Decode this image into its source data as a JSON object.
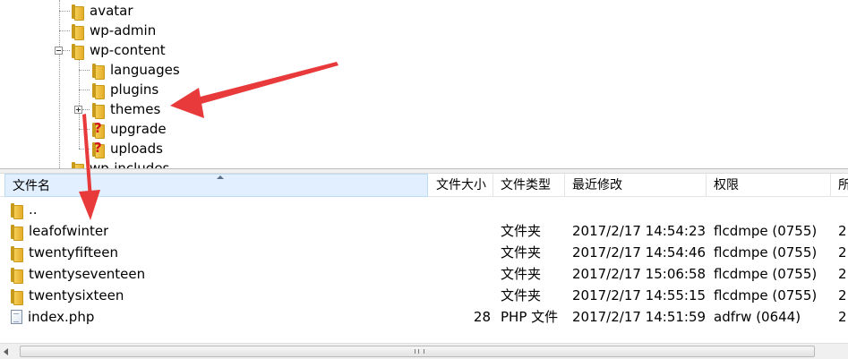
{
  "tree": {
    "items": [
      {
        "label": "avatar",
        "icon": "folder-icon"
      },
      {
        "label": "wp-admin",
        "icon": "folder-icon"
      },
      {
        "label": "wp-content",
        "icon": "folder-icon",
        "expanded": true
      },
      {
        "label": "languages",
        "icon": "folder-icon"
      },
      {
        "label": "plugins",
        "icon": "folder-icon"
      },
      {
        "label": "themes",
        "icon": "folder-icon",
        "collapsed_children": true
      },
      {
        "label": "upgrade",
        "icon": "unknown-folder-icon"
      },
      {
        "label": "uploads",
        "icon": "unknown-folder-icon"
      },
      {
        "label": "wp-includes",
        "icon": "folder-icon"
      }
    ]
  },
  "file_list": {
    "columns": {
      "name": "文件名",
      "size": "文件大小",
      "type": "文件类型",
      "modified": "最近修改",
      "permissions": "权限",
      "owner": "所"
    },
    "rows": [
      {
        "name": "..",
        "size": "",
        "type": "",
        "modified": "",
        "permissions": "",
        "owner": "",
        "icon": "folder-icon"
      },
      {
        "name": "leafofwinter",
        "size": "",
        "type": "文件夹",
        "modified": "2017/2/17 14:54:23",
        "permissions": "flcdmpe (0755)",
        "owner": "2",
        "icon": "folder-icon"
      },
      {
        "name": "twentyfifteen",
        "size": "",
        "type": "文件夹",
        "modified": "2017/2/17 14:54:46",
        "permissions": "flcdmpe (0755)",
        "owner": "2",
        "icon": "folder-icon"
      },
      {
        "name": "twentyseventeen",
        "size": "",
        "type": "文件夹",
        "modified": "2017/2/17 15:06:58",
        "permissions": "flcdmpe (0755)",
        "owner": "2",
        "icon": "folder-icon"
      },
      {
        "name": "twentysixteen",
        "size": "",
        "type": "文件夹",
        "modified": "2017/2/17 14:55:15",
        "permissions": "flcdmpe (0755)",
        "owner": "2",
        "icon": "folder-icon"
      },
      {
        "name": "index.php",
        "size": "28",
        "type": "PHP 文件",
        "modified": "2017/2/17 14:51:59",
        "permissions": "adfrw (0644)",
        "owner": "2",
        "icon": "file-icon"
      }
    ]
  },
  "colors": {
    "annotation_arrow": "#e8393b",
    "folder": "#f0c24a",
    "sorted_header": "#e2efff",
    "question_mark": "#d2161b"
  }
}
